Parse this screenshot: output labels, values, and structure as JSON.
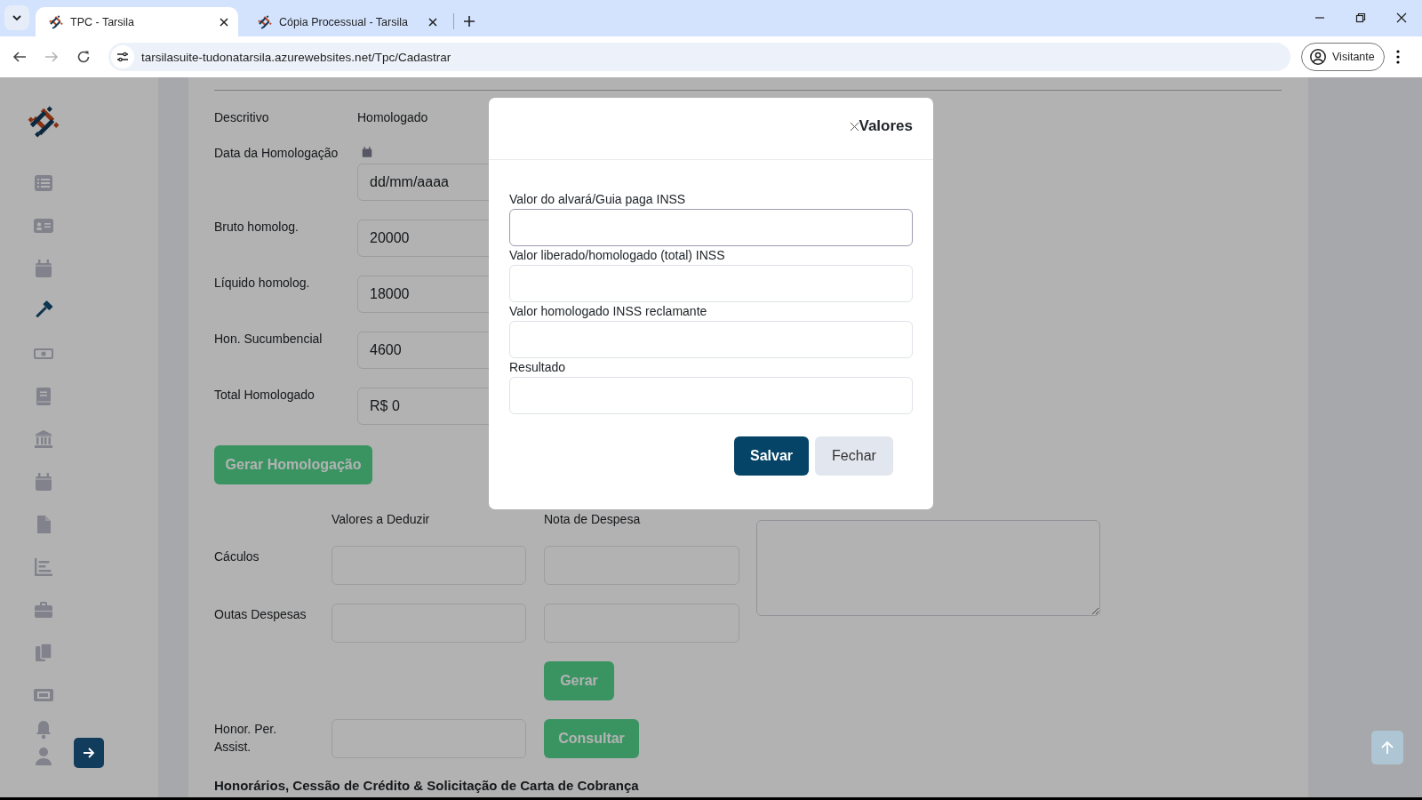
{
  "browser": {
    "tabs": [
      {
        "title": "TPC - Tarsila",
        "selected": true
      },
      {
        "title": "Cópia Processual - Tarsila",
        "selected": false
      }
    ],
    "nav_buttons": [
      {
        "kind": "back",
        "disabled": false
      },
      {
        "kind": "forward",
        "disabled": true
      },
      {
        "kind": "reload",
        "disabled": false
      }
    ],
    "url": "tarsilasuite-tudonatarsila.azurewebsites.net/Tpc/Cadastrar",
    "profile": "Visitante"
  },
  "sidebar": {
    "items": [
      {
        "selected": false
      },
      {
        "selected": false
      },
      {
        "selected": false
      },
      {
        "selected": true
      },
      {
        "selected": false
      },
      {
        "selected": false
      },
      {
        "selected": false
      },
      {
        "selected": false
      },
      {
        "selected": false
      },
      {
        "selected": false
      },
      {
        "selected": false
      },
      {
        "selected": false
      },
      {
        "selected": false
      }
    ],
    "bottom_items": [
      {
        "selected": false
      },
      {
        "selected": false
      }
    ]
  },
  "homologation": {
    "header": {
      "label": "Descritivo",
      "value": "Homologado"
    },
    "rows": [
      {
        "kind": "date",
        "label": "Data da Homologação",
        "placeholder": "dd/mm/aaaa"
      },
      {
        "kind": "text",
        "label": "Bruto homolog.",
        "value": "20000"
      },
      {
        "kind": "text",
        "label": "Líquido homolog.",
        "value": "18000"
      },
      {
        "kind": "text",
        "label": "Hon. Sucumbencial",
        "value": "4600"
      },
      {
        "kind": "text",
        "label": "Total Homologado",
        "value": "R$ 0"
      }
    ],
    "button": "Gerar Homologação"
  },
  "deductions": {
    "columns": [
      "Valores a Deduzir",
      "Nota de Despesa"
    ],
    "rows": [
      {
        "label": "Cáculos"
      },
      {
        "label": "Outas Despesas"
      }
    ],
    "generate_button": "Gerar",
    "assistance": {
      "label": "Honor. Per. Assist.",
      "button": "Consultar"
    }
  },
  "section_heading": "Honorários, Cessão de Crédito & Solicitação de Carta de Cobrança",
  "modal": {
    "title": "Valores",
    "fields": [
      {
        "label": "Valor do alvará/Guia paga INSS",
        "focused": true
      },
      {
        "label": "Valor liberado/homologado (total) INSS",
        "focused": false
      },
      {
        "label": "Valor homologado INSS reclamante",
        "focused": false
      },
      {
        "label": "Resultado",
        "focused": false
      }
    ],
    "buttons": [
      {
        "label": "Salvar",
        "kind": "primary"
      },
      {
        "label": "Fechar",
        "kind": "secondary"
      }
    ]
  }
}
